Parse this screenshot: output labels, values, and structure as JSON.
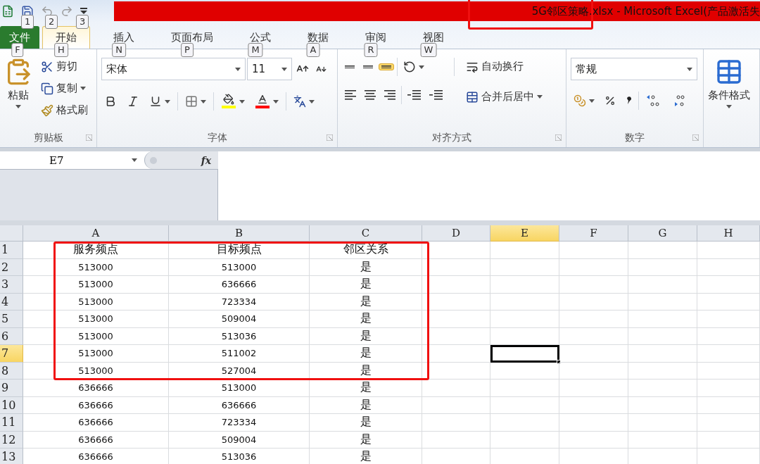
{
  "title_bar": {
    "title": "5G邻区策略.xlsx  -  Microsoft Excel(产品激活失",
    "key_tips": [
      "1",
      "2",
      "3"
    ]
  },
  "tabs": [
    {
      "label": "文件",
      "key_tip": "F",
      "kind": "file",
      "selected": false
    },
    {
      "label": "开始",
      "key_tip": "H",
      "kind": "tab",
      "selected": true
    },
    {
      "label": "插入",
      "key_tip": "N",
      "kind": "tab",
      "selected": false
    },
    {
      "label": "页面布局",
      "key_tip": "P",
      "kind": "tab",
      "selected": false
    },
    {
      "label": "公式",
      "key_tip": "M",
      "kind": "tab",
      "selected": false
    },
    {
      "label": "数据",
      "key_tip": "A",
      "kind": "tab",
      "selected": false
    },
    {
      "label": "审阅",
      "key_tip": "R",
      "kind": "tab",
      "selected": false
    },
    {
      "label": "视图",
      "key_tip": "W",
      "kind": "tab",
      "selected": false
    }
  ],
  "ribbon": {
    "clipboard": {
      "label": "剪贴板",
      "paste": "粘贴",
      "cut": "剪切",
      "copy": "复制",
      "format_painter": "格式刷"
    },
    "font": {
      "label": "字体",
      "font_name": "宋体",
      "font_size": "11"
    },
    "alignment": {
      "label": "对齐方式",
      "vertical_align": [
        {
          "selected": false
        },
        {
          "selected": false
        },
        {
          "selected": true
        }
      ],
      "wrap_text": "自动换行",
      "merge_center": "合并后居中"
    },
    "number": {
      "label": "数字",
      "format": "常规"
    },
    "styles": {
      "conditional_formatting": "条件格式"
    }
  },
  "formula_bar": {
    "name_box": "E7",
    "fx": "fx"
  },
  "sheet": {
    "columns": [
      {
        "label": "A",
        "selected": false
      },
      {
        "label": "B",
        "selected": false
      },
      {
        "label": "C",
        "selected": false
      },
      {
        "label": "D",
        "selected": false
      },
      {
        "label": "E",
        "selected": true
      },
      {
        "label": "F",
        "selected": false
      },
      {
        "label": "G",
        "selected": false
      },
      {
        "label": "H",
        "selected": false
      }
    ],
    "rows": [
      {
        "label": "1",
        "selected": false,
        "kind": "header",
        "cells": [
          "服务频点",
          "目标频点",
          "邻区关系"
        ]
      },
      {
        "label": "2",
        "selected": false,
        "kind": "data",
        "cells": [
          "513000",
          "513000",
          "是"
        ]
      },
      {
        "label": "3",
        "selected": false,
        "kind": "data",
        "cells": [
          "513000",
          "636666",
          "是"
        ]
      },
      {
        "label": "4",
        "selected": false,
        "kind": "data",
        "cells": [
          "513000",
          "723334",
          "是"
        ]
      },
      {
        "label": "5",
        "selected": false,
        "kind": "data",
        "cells": [
          "513000",
          "509004",
          "是"
        ]
      },
      {
        "label": "6",
        "selected": false,
        "kind": "data",
        "cells": [
          "513000",
          "513036",
          "是"
        ]
      },
      {
        "label": "7",
        "selected": true,
        "kind": "data",
        "cells": [
          "513000",
          "511002",
          "是"
        ]
      },
      {
        "label": "8",
        "selected": false,
        "kind": "data",
        "cells": [
          "513000",
          "527004",
          "是"
        ]
      },
      {
        "label": "9",
        "selected": false,
        "kind": "data",
        "cells": [
          "636666",
          "513000",
          "是"
        ]
      },
      {
        "label": "10",
        "selected": false,
        "kind": "data",
        "cells": [
          "636666",
          "636666",
          "是"
        ]
      },
      {
        "label": "11",
        "selected": false,
        "kind": "data",
        "cells": [
          "636666",
          "723334",
          "是"
        ]
      },
      {
        "label": "12",
        "selected": false,
        "kind": "data",
        "cells": [
          "636666",
          "509004",
          "是"
        ]
      },
      {
        "label": "13",
        "selected": false,
        "kind": "data",
        "cells": [
          "636666",
          "513036",
          "是"
        ]
      }
    ]
  }
}
